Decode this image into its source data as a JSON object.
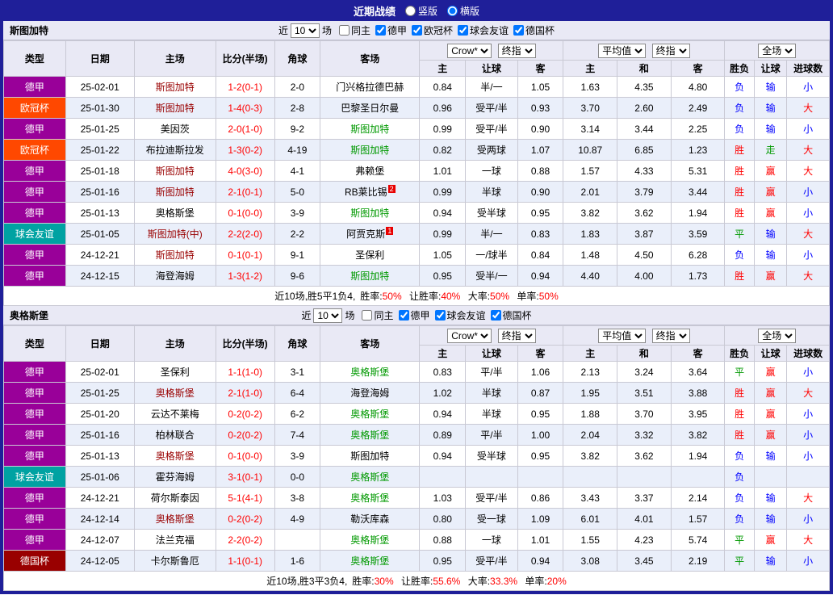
{
  "topbar": {
    "title": "近期战绩",
    "options": [
      {
        "label": "竖版",
        "selected": false
      },
      {
        "label": "横版",
        "selected": true
      }
    ]
  },
  "labels": {
    "near": "近",
    "unit": "场"
  },
  "table_headers": {
    "type": "类型",
    "date": "日期",
    "home": "主场",
    "score": "比分(半场)",
    "corner": "角球",
    "away": "客场",
    "ah_home": "主",
    "ah_line": "让球",
    "ah_away": "客",
    "eu_home": "主",
    "eu_draw": "和",
    "eu_away": "客",
    "result": "胜负",
    "ah_result": "让球",
    "goals": "进球数"
  },
  "colors": {
    "topbar_bg": "#1f1f99",
    "header_bg": "#e9e9f5",
    "stripe_bg": "#eaeffa",
    "league": {
      "德甲": "#990099",
      "欧冠杯": "#ff4800",
      "球会友谊": "#00a2a2",
      "德国杯": "#990000"
    },
    "team_subject_home": "#990000",
    "team_subject_away": "#009900",
    "team_opponent": "#000000",
    "score": "#ff0000",
    "win_red": "#ff0000",
    "draw_green": "#009900",
    "lose_blue": "#0000ff"
  },
  "sections": [
    {
      "team": "斯图加特",
      "filter": {
        "count": "10",
        "checkboxes": [
          {
            "label": "同主",
            "checked": false
          },
          {
            "label": "德甲",
            "checked": true
          },
          {
            "label": "欧冠杯",
            "checked": true
          },
          {
            "label": "球会友谊",
            "checked": true
          },
          {
            "label": "德国杯",
            "checked": true
          }
        ]
      },
      "dropdowns": {
        "book": "Crow*",
        "book_final": "终指",
        "avg": "平均值",
        "avg_final": "终指",
        "scope": "全场"
      },
      "rows": [
        {
          "league": "德甲",
          "date": "25-02-01",
          "home": "斯图加特",
          "score": "1-2(0-1)",
          "corner": "2-0",
          "away": "门兴格拉德巴赫",
          "ah": [
            "0.84",
            "半/一",
            "1.05"
          ],
          "eu": [
            "1.63",
            "4.35",
            "4.80"
          ],
          "res": "负",
          "ahRes": "输",
          "ou": "小"
        },
        {
          "league": "欧冠杯",
          "date": "25-01-30",
          "home": "斯图加特",
          "score": "1-4(0-3)",
          "corner": "2-8",
          "away": "巴黎圣日尔曼",
          "ah": [
            "0.96",
            "受平/半",
            "0.93"
          ],
          "eu": [
            "3.70",
            "2.60",
            "2.49"
          ],
          "res": "负",
          "ahRes": "输",
          "ou": "大"
        },
        {
          "league": "德甲",
          "date": "25-01-25",
          "home": "美因茨",
          "score": "2-0(1-0)",
          "corner": "9-2",
          "away": "斯图加特",
          "ah": [
            "0.99",
            "受平/半",
            "0.90"
          ],
          "eu": [
            "3.14",
            "3.44",
            "2.25"
          ],
          "res": "负",
          "ahRes": "输",
          "ou": "小"
        },
        {
          "league": "欧冠杯",
          "date": "25-01-22",
          "home": "布拉迪斯拉发",
          "score": "1-3(0-2)",
          "corner": "4-19",
          "away": "斯图加特",
          "ah": [
            "0.82",
            "受两球",
            "1.07"
          ],
          "eu": [
            "10.87",
            "6.85",
            "1.23"
          ],
          "res": "胜",
          "ahRes": "走",
          "ou": "大"
        },
        {
          "league": "德甲",
          "date": "25-01-18",
          "home": "斯图加特",
          "score": "4-0(3-0)",
          "corner": "4-1",
          "away": "弗赖堡",
          "ah": [
            "1.01",
            "一球",
            "0.88"
          ],
          "eu": [
            "1.57",
            "4.33",
            "5.31"
          ],
          "res": "胜",
          "ahRes": "赢",
          "ou": "大"
        },
        {
          "league": "德甲",
          "date": "25-01-16",
          "home": "斯图加特",
          "score": "2-1(0-1)",
          "corner": "5-0",
          "away": "RB莱比锡",
          "awayBadge": "2",
          "ah": [
            "0.99",
            "半球",
            "0.90"
          ],
          "eu": [
            "2.01",
            "3.79",
            "3.44"
          ],
          "res": "胜",
          "ahRes": "赢",
          "ou": "小"
        },
        {
          "league": "德甲",
          "date": "25-01-13",
          "home": "奥格斯堡",
          "score": "0-1(0-0)",
          "corner": "3-9",
          "away": "斯图加特",
          "ah": [
            "0.94",
            "受半球",
            "0.95"
          ],
          "eu": [
            "3.82",
            "3.62",
            "1.94"
          ],
          "res": "胜",
          "ahRes": "赢",
          "ou": "小"
        },
        {
          "league": "球会友谊",
          "date": "25-01-05",
          "home": "斯图加特(中)",
          "score": "2-2(2-0)",
          "corner": "2-2",
          "away": "阿贾克斯",
          "awayBadge": "1",
          "ah": [
            "0.99",
            "半/一",
            "0.83"
          ],
          "eu": [
            "1.83",
            "3.87",
            "3.59"
          ],
          "res": "平",
          "ahRes": "输",
          "ou": "大"
        },
        {
          "league": "德甲",
          "date": "24-12-21",
          "home": "斯图加特",
          "score": "0-1(0-1)",
          "corner": "9-1",
          "away": "圣保利",
          "ah": [
            "1.05",
            "一/球半",
            "0.84"
          ],
          "eu": [
            "1.48",
            "4.50",
            "6.28"
          ],
          "res": "负",
          "ahRes": "输",
          "ou": "小"
        },
        {
          "league": "德甲",
          "date": "24-12-15",
          "home": "海登海姆",
          "score": "1-3(1-2)",
          "corner": "9-6",
          "away": "斯图加特",
          "ah": [
            "0.95",
            "受半/一",
            "0.94"
          ],
          "eu": [
            "4.40",
            "4.00",
            "1.73"
          ],
          "res": "胜",
          "ahRes": "赢",
          "ou": "大"
        }
      ],
      "summary": {
        "prefix": "近10场,胜5平1负4,",
        "stats": [
          {
            "label": "胜率:",
            "value": "50%"
          },
          {
            "label": "让胜率:",
            "value": "40%"
          },
          {
            "label": "大率:",
            "value": "50%"
          },
          {
            "label": "单率:",
            "value": "50%"
          }
        ]
      }
    },
    {
      "team": "奥格斯堡",
      "filter": {
        "count": "10",
        "checkboxes": [
          {
            "label": "同主",
            "checked": false
          },
          {
            "label": "德甲",
            "checked": true
          },
          {
            "label": "球会友谊",
            "checked": true
          },
          {
            "label": "德国杯",
            "checked": true
          }
        ]
      },
      "dropdowns": {
        "book": "Crow*",
        "book_final": "终指",
        "avg": "平均值",
        "avg_final": "终指",
        "scope": "全场"
      },
      "rows": [
        {
          "league": "德甲",
          "date": "25-02-01",
          "home": "圣保利",
          "score": "1-1(1-0)",
          "corner": "3-1",
          "away": "奥格斯堡",
          "ah": [
            "0.83",
            "平/半",
            "1.06"
          ],
          "eu": [
            "2.13",
            "3.24",
            "3.64"
          ],
          "res": "平",
          "ahRes": "赢",
          "ou": "小"
        },
        {
          "league": "德甲",
          "date": "25-01-25",
          "home": "奥格斯堡",
          "score": "2-1(1-0)",
          "corner": "6-4",
          "away": "海登海姆",
          "ah": [
            "1.02",
            "半球",
            "0.87"
          ],
          "eu": [
            "1.95",
            "3.51",
            "3.88"
          ],
          "res": "胜",
          "ahRes": "赢",
          "ou": "大"
        },
        {
          "league": "德甲",
          "date": "25-01-20",
          "home": "云达不莱梅",
          "score": "0-2(0-2)",
          "corner": "6-2",
          "away": "奥格斯堡",
          "ah": [
            "0.94",
            "半球",
            "0.95"
          ],
          "eu": [
            "1.88",
            "3.70",
            "3.95"
          ],
          "res": "胜",
          "ahRes": "赢",
          "ou": "小"
        },
        {
          "league": "德甲",
          "date": "25-01-16",
          "home": "柏林联合",
          "score": "0-2(0-2)",
          "corner": "7-4",
          "away": "奥格斯堡",
          "ah": [
            "0.89",
            "平/半",
            "1.00"
          ],
          "eu": [
            "2.04",
            "3.32",
            "3.82"
          ],
          "res": "胜",
          "ahRes": "赢",
          "ou": "小"
        },
        {
          "league": "德甲",
          "date": "25-01-13",
          "home": "奥格斯堡",
          "score": "0-1(0-0)",
          "corner": "3-9",
          "away": "斯图加特",
          "ah": [
            "0.94",
            "受半球",
            "0.95"
          ],
          "eu": [
            "3.82",
            "3.62",
            "1.94"
          ],
          "res": "负",
          "ahRes": "输",
          "ou": "小"
        },
        {
          "league": "球会友谊",
          "date": "25-01-06",
          "home": "霍芬海姆",
          "score": "3-1(0-1)",
          "corner": "0-0",
          "away": "奥格斯堡",
          "ah": [
            "",
            "",
            ""
          ],
          "eu": [
            "",
            "",
            ""
          ],
          "res": "负",
          "ahRes": "",
          "ou": ""
        },
        {
          "league": "德甲",
          "date": "24-12-21",
          "home": "荷尔斯泰因",
          "score": "5-1(4-1)",
          "corner": "3-8",
          "away": "奥格斯堡",
          "ah": [
            "1.03",
            "受平/半",
            "0.86"
          ],
          "eu": [
            "3.43",
            "3.37",
            "2.14"
          ],
          "res": "负",
          "ahRes": "输",
          "ou": "大"
        },
        {
          "league": "德甲",
          "date": "24-12-14",
          "home": "奥格斯堡",
          "score": "0-2(0-2)",
          "corner": "4-9",
          "away": "勒沃库森",
          "ah": [
            "0.80",
            "受一球",
            "1.09"
          ],
          "eu": [
            "6.01",
            "4.01",
            "1.57"
          ],
          "res": "负",
          "ahRes": "输",
          "ou": "小"
        },
        {
          "league": "德甲",
          "date": "24-12-07",
          "home": "法兰克福",
          "score": "2-2(0-2)",
          "corner": "",
          "away": "奥格斯堡",
          "ah": [
            "0.88",
            "一球",
            "1.01"
          ],
          "eu": [
            "1.55",
            "4.23",
            "5.74"
          ],
          "res": "平",
          "ahRes": "赢",
          "ou": "大"
        },
        {
          "league": "德国杯",
          "date": "24-12-05",
          "home": "卡尔斯鲁厄",
          "score": "1-1(0-1)",
          "corner": "1-6",
          "away": "奥格斯堡",
          "ah": [
            "0.95",
            "受平/半",
            "0.94"
          ],
          "eu": [
            "3.08",
            "3.45",
            "2.19"
          ],
          "res": "平",
          "ahRes": "输",
          "ou": "小"
        }
      ],
      "summary": {
        "prefix": "近10场,胜3平3负4,",
        "stats": [
          {
            "label": "胜率:",
            "value": "30%"
          },
          {
            "label": "让胜率:",
            "value": "55.6%"
          },
          {
            "label": "大率:",
            "value": "33.3%"
          },
          {
            "label": "单率:",
            "value": "20%"
          }
        ]
      }
    }
  ]
}
